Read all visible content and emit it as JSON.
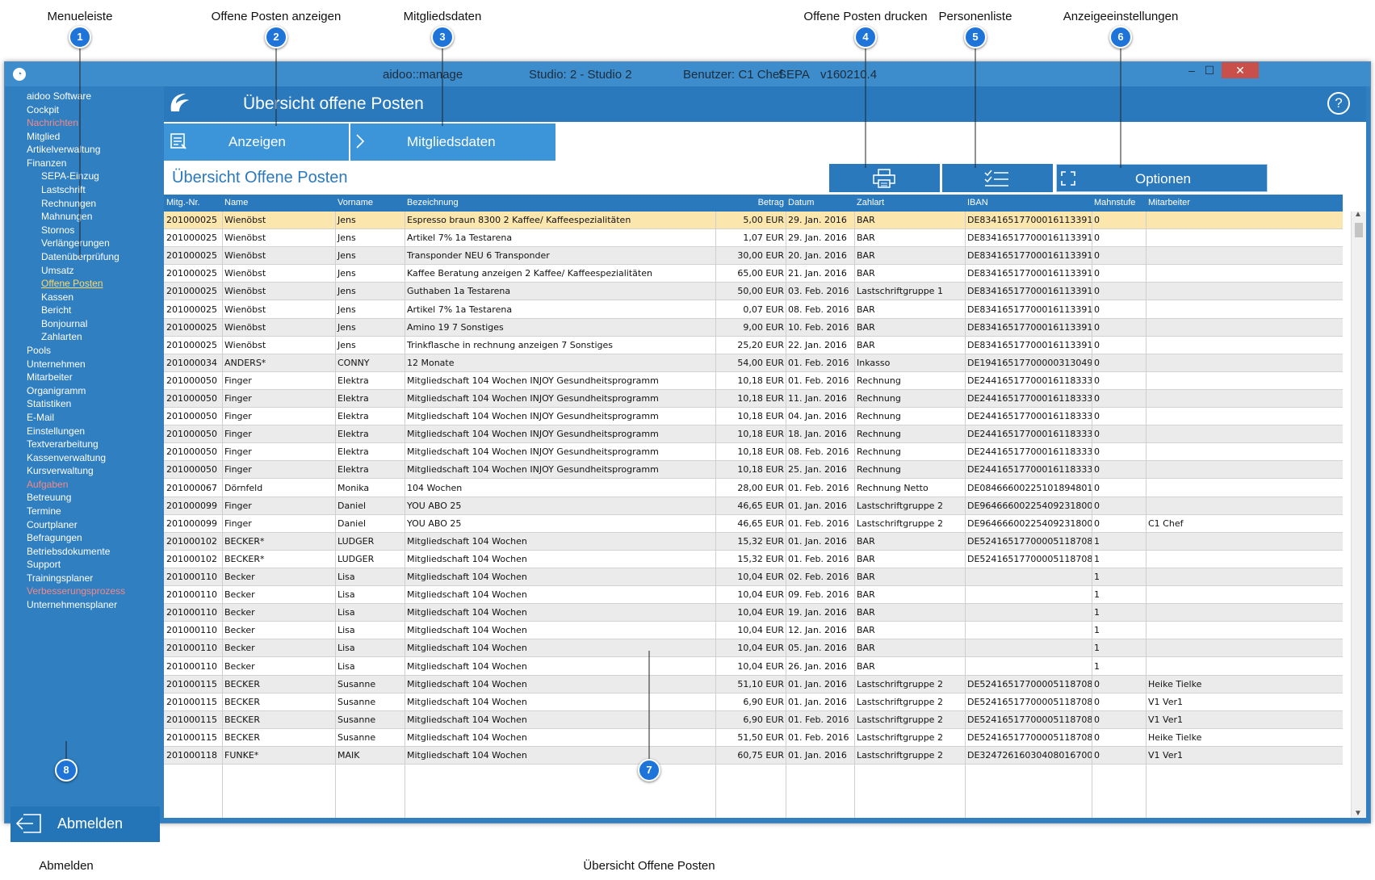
{
  "callouts": [
    {
      "num": "1",
      "label": "Menueleiste"
    },
    {
      "num": "2",
      "label": "Offene Posten anzeigen"
    },
    {
      "num": "3",
      "label": "Mitgliedsdaten"
    },
    {
      "num": "4",
      "label": "Offene Posten drucken"
    },
    {
      "num": "5",
      "label": "Personenliste"
    },
    {
      "num": "6",
      "label": "Anzeigeeinstellungen"
    },
    {
      "num": "7",
      "label": "Übersicht Offene Posten"
    },
    {
      "num": "8",
      "label": "Abmelden"
    }
  ],
  "window": {
    "app": "aidoo::manage",
    "studio": "Studio: 2 - Studio 2",
    "user": "Benutzer: C1 Chef",
    "sepa": "SEPA",
    "version": "v160210.4",
    "minimize": "–",
    "maximize": "☐",
    "close": "✕"
  },
  "sidebar": {
    "items": [
      {
        "label": "aidoo Software",
        "state": "normal"
      },
      {
        "label": "Cockpit",
        "state": "normal"
      },
      {
        "label": "Nachrichten",
        "state": "disabled"
      },
      {
        "label": "Mitglied",
        "state": "normal"
      },
      {
        "label": "Artikelverwaltung",
        "state": "normal"
      },
      {
        "label": "Finanzen",
        "state": "normal"
      },
      {
        "label": "SEPA-Einzug",
        "state": "normal",
        "sub": true
      },
      {
        "label": "Lastschrift",
        "state": "normal",
        "sub": true
      },
      {
        "label": "Rechnungen",
        "state": "normal",
        "sub": true
      },
      {
        "label": "Mahnungen",
        "state": "normal",
        "sub": true
      },
      {
        "label": "Stornos",
        "state": "normal",
        "sub": true
      },
      {
        "label": "Verlängerungen",
        "state": "normal",
        "sub": true
      },
      {
        "label": "Datenüberprüfung",
        "state": "normal",
        "sub": true
      },
      {
        "label": "Umsatz",
        "state": "normal",
        "sub": true
      },
      {
        "label": "Offene Posten",
        "state": "active",
        "sub": true
      },
      {
        "label": "Kassen",
        "state": "normal",
        "sub": true
      },
      {
        "label": "Bericht",
        "state": "normal",
        "sub": true
      },
      {
        "label": "Bonjournal",
        "state": "normal",
        "sub": true
      },
      {
        "label": "Zahlarten",
        "state": "normal",
        "sub": true
      },
      {
        "label": "Pools",
        "state": "normal"
      },
      {
        "label": "Unternehmen",
        "state": "normal"
      },
      {
        "label": "Mitarbeiter",
        "state": "normal"
      },
      {
        "label": "Organigramm",
        "state": "normal"
      },
      {
        "label": "Statistiken",
        "state": "normal"
      },
      {
        "label": "E-Mail",
        "state": "normal"
      },
      {
        "label": "Einstellungen",
        "state": "normal"
      },
      {
        "label": "Textverarbeitung",
        "state": "normal"
      },
      {
        "label": "Kassenverwaltung",
        "state": "normal"
      },
      {
        "label": "Kursverwaltung",
        "state": "normal"
      },
      {
        "label": "Aufgaben",
        "state": "disabled"
      },
      {
        "label": "Betreuung",
        "state": "normal"
      },
      {
        "label": "Termine",
        "state": "normal"
      },
      {
        "label": "Courtplaner",
        "state": "normal"
      },
      {
        "label": "Befragungen",
        "state": "normal"
      },
      {
        "label": "Betriebsdokumente",
        "state": "normal"
      },
      {
        "label": "Support",
        "state": "normal"
      },
      {
        "label": "Trainingsplaner",
        "state": "normal"
      },
      {
        "label": "Verbesserungsprozess",
        "state": "disabled"
      },
      {
        "label": "Unternehmensplaner",
        "state": "normal"
      }
    ],
    "logout": "Abmelden"
  },
  "header": {
    "title": "Übersicht offene Posten",
    "help": "?"
  },
  "tabs": {
    "show": "Anzeigen",
    "member": "Mitgliedsdaten"
  },
  "toolbar": {
    "title": "Übersicht Offene Posten",
    "options": "Optionen"
  },
  "table": {
    "columns": [
      "Mitg.-Nr.",
      "Name",
      "Vorname",
      "Bezeichnung",
      "Betrag",
      "Datum",
      "Zahlart",
      "IBAN",
      "Mahnstufe",
      "Mitarbeiter"
    ],
    "rows": [
      [
        "201000025",
        "Wienöbst",
        "Jens",
        "Espresso braun 8300  2 Kaffee/ Kaffeespezialitäten",
        "5,00 EUR",
        "29. Jan. 2016",
        "BAR",
        "DE83416517700016113391",
        "0",
        ""
      ],
      [
        "201000025",
        "Wienöbst",
        "Jens",
        "Artikel 7%  1a Testarena",
        "1,07 EUR",
        "29. Jan. 2016",
        "BAR",
        "DE83416517700016113391",
        "0",
        ""
      ],
      [
        "201000025",
        "Wienöbst",
        "Jens",
        "Transponder NEU  6 Transponder",
        "30,00 EUR",
        "20. Jan. 2016",
        "BAR",
        "DE83416517700016113391",
        "0",
        ""
      ],
      [
        "201000025",
        "Wienöbst",
        "Jens",
        "Kaffee Beratung anzeigen 2 Kaffee/ Kaffeespezialitäten",
        "65,00 EUR",
        "21. Jan. 2016",
        "BAR",
        "DE83416517700016113391",
        "0",
        ""
      ],
      [
        "201000025",
        "Wienöbst",
        "Jens",
        "Guthaben  1a Testarena",
        "50,00 EUR",
        "03. Feb. 2016",
        "Lastschriftgruppe 1",
        "DE83416517700016113391",
        "0",
        ""
      ],
      [
        "201000025",
        "Wienöbst",
        "Jens",
        "Artikel 7%  1a Testarena",
        "0,07 EUR",
        "08. Feb. 2016",
        "BAR",
        "DE83416517700016113391",
        "0",
        ""
      ],
      [
        "201000025",
        "Wienöbst",
        "Jens",
        "Amino 19  7 Sonstiges",
        "9,00 EUR",
        "10. Feb. 2016",
        "BAR",
        "DE83416517700016113391",
        "0",
        ""
      ],
      [
        "201000025",
        "Wienöbst",
        "Jens",
        "Trinkflasche in rechnung anzeigen 7 Sonstiges",
        "25,20 EUR",
        "22. Jan. 2016",
        "BAR",
        "DE83416517700016113391",
        "0",
        ""
      ],
      [
        "201000034",
        "ANDERS*",
        "CONNY",
        "12 Monate",
        "54,00 EUR",
        "01. Feb. 2016",
        "Inkasso",
        "DE19416517700000313049",
        "0",
        ""
      ],
      [
        "201000050",
        "Finger",
        "Elektra",
        "Mitgliedschaft 104 Wochen INJOY Gesundheitsprogramm",
        "10,18 EUR",
        "01. Feb. 2016",
        "Rechnung",
        "DE24416517700016118333",
        "0",
        ""
      ],
      [
        "201000050",
        "Finger",
        "Elektra",
        "Mitgliedschaft 104 Wochen INJOY Gesundheitsprogramm",
        "10,18 EUR",
        "11. Jan. 2016",
        "Rechnung",
        "DE24416517700016118333",
        "0",
        ""
      ],
      [
        "201000050",
        "Finger",
        "Elektra",
        "Mitgliedschaft 104 Wochen INJOY Gesundheitsprogramm",
        "10,18 EUR",
        "04. Jan. 2016",
        "Rechnung",
        "DE24416517700016118333",
        "0",
        ""
      ],
      [
        "201000050",
        "Finger",
        "Elektra",
        "Mitgliedschaft 104 Wochen INJOY Gesundheitsprogramm",
        "10,18 EUR",
        "18. Jan. 2016",
        "Rechnung",
        "DE24416517700016118333",
        "0",
        ""
      ],
      [
        "201000050",
        "Finger",
        "Elektra",
        "Mitgliedschaft 104 Wochen INJOY Gesundheitsprogramm",
        "10,18 EUR",
        "08. Feb. 2016",
        "Rechnung",
        "DE24416517700016118333",
        "0",
        ""
      ],
      [
        "201000050",
        "Finger",
        "Elektra",
        "Mitgliedschaft 104 Wochen INJOY Gesundheitsprogramm",
        "10,18 EUR",
        "25. Jan. 2016",
        "Rechnung",
        "DE24416517700016118333",
        "0",
        ""
      ],
      [
        "201000067",
        "Dörnfeld",
        "Monika",
        "104 Wochen",
        "28,00 EUR",
        "01. Feb. 2016",
        "Rechnung Netto",
        "DE08466600225101894801",
        "0",
        ""
      ],
      [
        "201000099",
        "Finger",
        "Daniel",
        "YOU ABO 25",
        "46,65 EUR",
        "01. Jan. 2016",
        "Lastschriftgruppe 2",
        "DE96466600225409231800",
        "0",
        ""
      ],
      [
        "201000099",
        "Finger",
        "Daniel",
        "YOU ABO 25",
        "46,65 EUR",
        "01. Feb. 2016",
        "Lastschriftgruppe 2",
        "DE96466600225409231800",
        "0",
        "C1 Chef"
      ],
      [
        "201000102",
        "BECKER*",
        "LUDGER",
        "Mitgliedschaft 104 Wochen",
        "15,32 EUR",
        "01. Jan. 2016",
        "BAR",
        "DE52416517700005118708",
        "1",
        ""
      ],
      [
        "201000102",
        "BECKER*",
        "LUDGER",
        "Mitgliedschaft 104 Wochen",
        "15,32 EUR",
        "01. Feb. 2016",
        "BAR",
        "DE52416517700005118708",
        "1",
        ""
      ],
      [
        "201000110",
        "Becker",
        "Lisa",
        "Mitgliedschaft 104 Wochen",
        "10,04 EUR",
        "02. Feb. 2016",
        "BAR",
        "",
        "1",
        ""
      ],
      [
        "201000110",
        "Becker",
        "Lisa",
        "Mitgliedschaft 104 Wochen",
        "10,04 EUR",
        "09. Feb. 2016",
        "BAR",
        "",
        "1",
        ""
      ],
      [
        "201000110",
        "Becker",
        "Lisa",
        "Mitgliedschaft 104 Wochen",
        "10,04 EUR",
        "19. Jan. 2016",
        "BAR",
        "",
        "1",
        ""
      ],
      [
        "201000110",
        "Becker",
        "Lisa",
        "Mitgliedschaft 104 Wochen",
        "10,04 EUR",
        "12. Jan. 2016",
        "BAR",
        "",
        "1",
        ""
      ],
      [
        "201000110",
        "Becker",
        "Lisa",
        "Mitgliedschaft 104 Wochen",
        "10,04 EUR",
        "05. Jan. 2016",
        "BAR",
        "",
        "1",
        ""
      ],
      [
        "201000110",
        "Becker",
        "Lisa",
        "Mitgliedschaft 104 Wochen",
        "10,04 EUR",
        "26. Jan. 2016",
        "BAR",
        "",
        "1",
        ""
      ],
      [
        "201000115",
        "BECKER",
        "Susanne",
        "Mitgliedschaft 104 Wochen",
        "51,10 EUR",
        "01. Jan. 2016",
        "Lastschriftgruppe 2",
        "DE52416517700005118708",
        "0",
        "Heike Tielke"
      ],
      [
        "201000115",
        "BECKER",
        "Susanne",
        "Mitgliedschaft 104 Wochen",
        "6,90 EUR",
        "01. Jan. 2016",
        "Lastschriftgruppe 2",
        "DE52416517700005118708",
        "0",
        "V1 Ver1"
      ],
      [
        "201000115",
        "BECKER",
        "Susanne",
        "Mitgliedschaft 104 Wochen",
        "6,90 EUR",
        "01. Feb. 2016",
        "Lastschriftgruppe 2",
        "DE52416517700005118708",
        "0",
        "V1 Ver1"
      ],
      [
        "201000115",
        "BECKER",
        "Susanne",
        "Mitgliedschaft 104 Wochen",
        "51,50 EUR",
        "01. Feb. 2016",
        "Lastschriftgruppe 2",
        "DE52416517700005118708",
        "0",
        "Heike Tielke"
      ],
      [
        "201000118",
        "FUNKE*",
        "MAIK",
        "Mitgliedschaft 104 Wochen",
        "60,75 EUR",
        "01. Jan. 2016",
        "Lastschriftgruppe 2",
        "DE32472616030408016700",
        "0",
        "V1 Ver1"
      ]
    ]
  },
  "colors": {
    "accent": "#2a79bd",
    "sidebar": "#2f7fc1",
    "badge": "#1e74d8",
    "selected_row": "#fbe6ae",
    "disabled_nav": "#f28a8a",
    "active_nav": "#ffd966"
  }
}
